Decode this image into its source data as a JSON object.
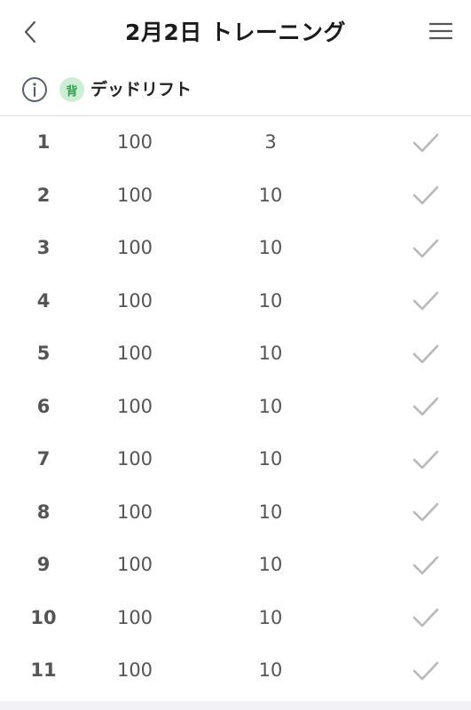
{
  "header": {
    "back_icon": "chevron-left-icon",
    "title": "2月2日  トレーニング",
    "menu_icon": "hamburger-menu-icon"
  },
  "exercise": {
    "info_icon": "info-icon",
    "body_part_badge": "背",
    "name": "デッドリフト",
    "badge_color": "#cdeed4"
  },
  "sets": [
    {
      "number": "1",
      "weight": "100",
      "reps": "3"
    },
    {
      "number": "2",
      "weight": "100",
      "reps": "10"
    },
    {
      "number": "3",
      "weight": "100",
      "reps": "10"
    },
    {
      "number": "4",
      "weight": "100",
      "reps": "10"
    },
    {
      "number": "5",
      "weight": "100",
      "reps": "10"
    },
    {
      "number": "6",
      "weight": "100",
      "reps": "10"
    },
    {
      "number": "7",
      "weight": "100",
      "reps": "10"
    },
    {
      "number": "8",
      "weight": "100",
      "reps": "10"
    },
    {
      "number": "9",
      "weight": "100",
      "reps": "10"
    },
    {
      "number": "10",
      "weight": "100",
      "reps": "10"
    },
    {
      "number": "11",
      "weight": "100",
      "reps": "10"
    }
  ],
  "colors": {
    "check": "#b8b8b8",
    "text_secondary": "#555555",
    "divider": "#dcdcdc"
  }
}
